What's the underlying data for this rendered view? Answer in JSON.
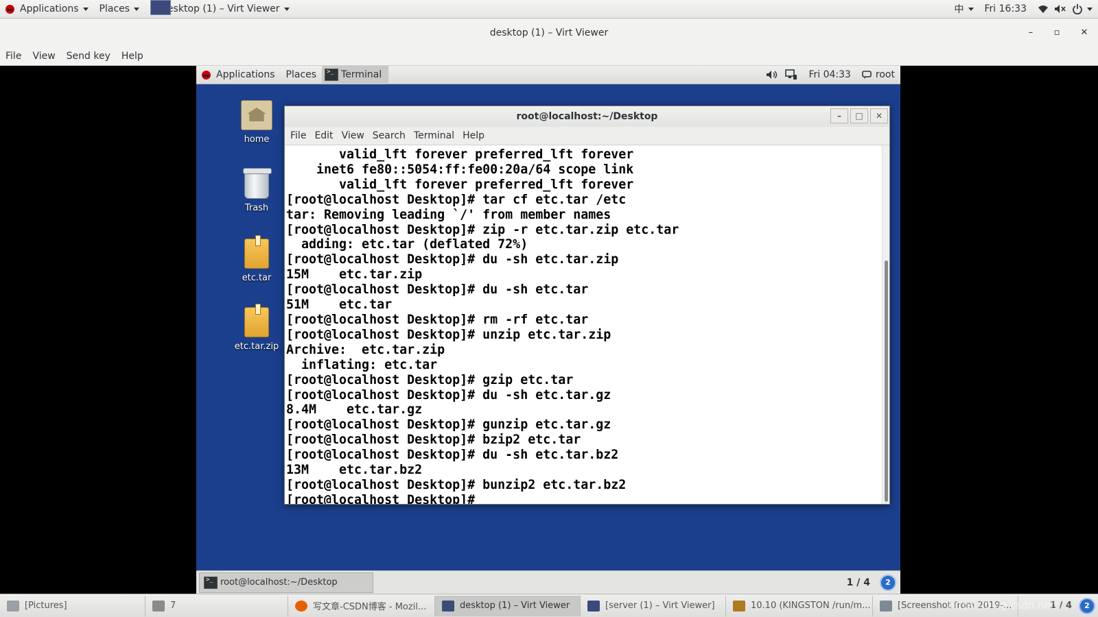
{
  "host_panel": {
    "applications": "Applications",
    "places": "Places",
    "window_title": "desktop (1) – Virt Viewer",
    "input_method": "中",
    "clock": "Fri 16:33"
  },
  "viewer": {
    "title": "desktop (1) – Virt Viewer",
    "menu": [
      "File",
      "View",
      "Send key",
      "Help"
    ]
  },
  "guest": {
    "panel": {
      "applications": "Applications",
      "places": "Places",
      "terminal_task": "Terminal",
      "clock": "Fri 04:33",
      "user": "root"
    },
    "desktop_icons": [
      {
        "label": "home",
        "icon": "home-folder-icon"
      },
      {
        "label": "Trash",
        "icon": "trash-icon"
      },
      {
        "label": "etc.tar",
        "icon": "package-icon"
      },
      {
        "label": "etc.tar.zip",
        "icon": "package-icon"
      }
    ],
    "terminal": {
      "title": "root@localhost:~/Desktop",
      "menu": [
        "File",
        "Edit",
        "View",
        "Search",
        "Terminal",
        "Help"
      ],
      "lines": [
        "       valid_lft forever preferred_lft forever",
        "    inet6 fe80::5054:ff:fe00:20a/64 scope link",
        "       valid_lft forever preferred_lft forever",
        "[root@localhost Desktop]# tar cf etc.tar /etc",
        "tar: Removing leading `/' from member names",
        "[root@localhost Desktop]# zip -r etc.tar.zip etc.tar",
        "  adding: etc.tar (deflated 72%)",
        "[root@localhost Desktop]# du -sh etc.tar.zip",
        "15M\tetc.tar.zip",
        "[root@localhost Desktop]# du -sh etc.tar",
        "51M\tetc.tar",
        "[root@localhost Desktop]# rm -rf etc.tar",
        "[root@localhost Desktop]# unzip etc.tar.zip",
        "Archive:  etc.tar.zip",
        "  inflating: etc.tar",
        "[root@localhost Desktop]# gzip etc.tar",
        "[root@localhost Desktop]# du -sh etc.tar.gz",
        "8.4M\tetc.tar.gz",
        "[root@localhost Desktop]# gunzip etc.tar.gz",
        "[root@localhost Desktop]# bzip2 etc.tar",
        "[root@localhost Desktop]# du -sh etc.tar.bz2",
        "13M\tetc.tar.bz2",
        "[root@localhost Desktop]# bunzip2 etc.tar.bz2",
        "[root@localhost Desktop]# "
      ]
    },
    "bottom_bar": {
      "task": "root@localhost:~/Desktop",
      "pager": "1 / 4",
      "badge": "2"
    }
  },
  "host_taskbar": {
    "tasks": [
      {
        "label": "[Pictures]",
        "icon": "folder-icon",
        "active": false
      },
      {
        "label": "7",
        "icon": "document-icon",
        "active": false
      },
      {
        "label": "写文章-CSDN博客 - Mozil...",
        "icon": "firefox-icon",
        "active": false
      },
      {
        "label": "desktop (1) – Virt Viewer",
        "icon": "monitor-icon",
        "active": true
      },
      {
        "label": "[server (1) – Virt Viewer]",
        "icon": "monitor-icon",
        "active": false
      },
      {
        "label": "10.10 (KINGSTON /run/m...",
        "icon": "text-editor-icon",
        "active": false
      },
      {
        "label": "[Screenshot from 2019-...",
        "icon": "screenshot-icon",
        "active": false
      }
    ],
    "pager": "1 / 4",
    "watermark": "https://blog.csdn.net/..."
  }
}
